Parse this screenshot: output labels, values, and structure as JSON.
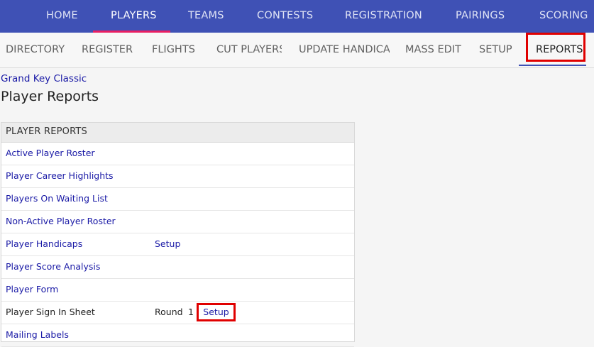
{
  "top_nav": {
    "items": [
      "HOME",
      "PLAYERS",
      "TEAMS",
      "CONTESTS",
      "REGISTRATION",
      "PAIRINGS",
      "SCORING"
    ],
    "active": "PLAYERS"
  },
  "sub_nav": {
    "items": [
      "DIRECTORY",
      "REGISTER",
      "FLIGHTS",
      "CUT PLAYERS",
      "UPDATE HANDICA",
      "MASS EDIT",
      "SETUP",
      "REPORTS"
    ],
    "active": "REPORTS"
  },
  "tournament_name": "Grand Key Classic",
  "page_title": "Player Reports",
  "panel": {
    "title": "PLAYER REPORTS",
    "rows": [
      {
        "label": "Active Player Roster"
      },
      {
        "label": "Player Career Highlights"
      },
      {
        "label": "Players On Waiting List"
      },
      {
        "label": "Non-Active Player Roster"
      },
      {
        "label": "Player Handicaps",
        "extra": "Setup"
      },
      {
        "label": "Player Score Analysis"
      },
      {
        "label": "Player Form"
      },
      {
        "label": "Player Sign In Sheet",
        "round_label": "Round",
        "round_value": "1",
        "setup": "Setup"
      },
      {
        "label": "Mailing Labels"
      }
    ]
  },
  "colors": {
    "top_nav_bg": "#3f51b5",
    "active_underline": "#e91e63",
    "highlight_box": "#e00000",
    "link": "#1a1aa6"
  }
}
